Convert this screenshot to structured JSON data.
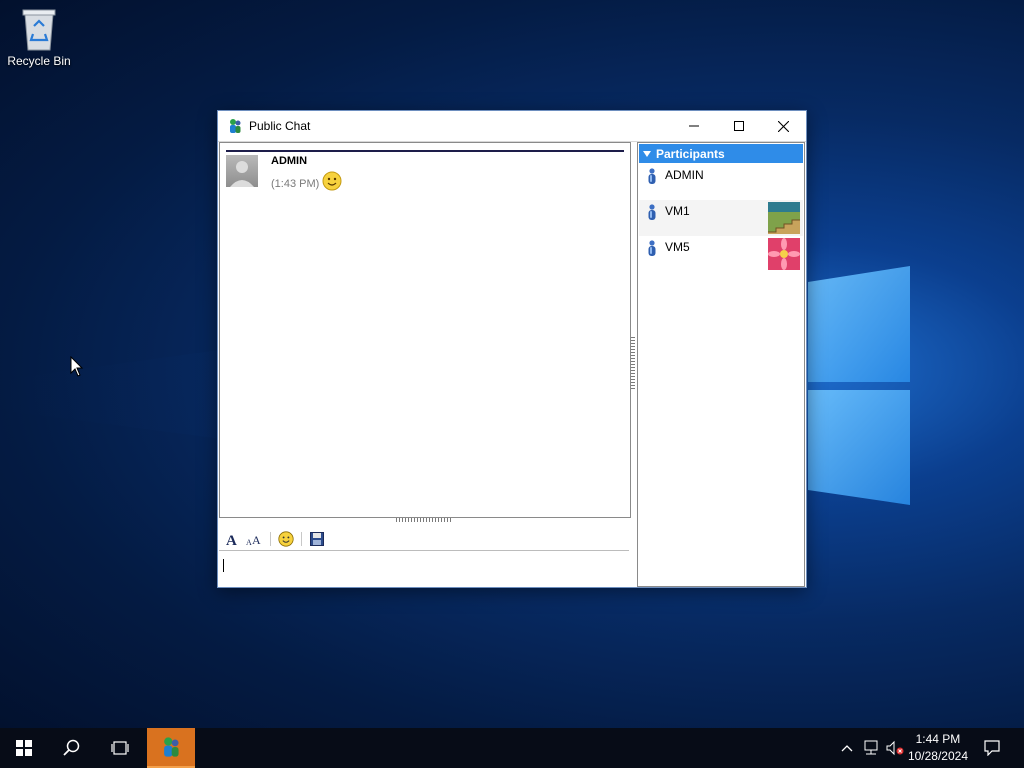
{
  "desktop": {
    "icons": [
      {
        "label": "Recycle Bin",
        "icon": "recycle-bin-icon"
      }
    ]
  },
  "window": {
    "title": "Public Chat",
    "icon": "chat-app-icon",
    "controls": {
      "minimize": "minimize-icon",
      "maximize": "maximize-icon",
      "close": "close-icon"
    }
  },
  "chat": {
    "messages": [
      {
        "sender": "ADMIN",
        "time": "(1:43 PM)",
        "emoji": "smiley-emoji"
      }
    ],
    "toolbar": [
      "font-icon",
      "font-size-icon",
      "emoticon-icon",
      "save-icon"
    ],
    "input_value": ""
  },
  "participants": {
    "header": "Participants",
    "items": [
      {
        "name": "ADMIN",
        "thumbnail": null
      },
      {
        "name": "VM1",
        "thumbnail": "stairs-thumbnail"
      },
      {
        "name": "VM5",
        "thumbnail": "flower-thumbnail"
      }
    ]
  },
  "taskbar": {
    "items": [
      "start-icon",
      "search-icon",
      "task-view-icon",
      "chat-app-icon"
    ],
    "tray": {
      "time": "1:44 PM",
      "date": "10/28/2024",
      "icons": [
        "chevron-up-icon",
        "network-icon",
        "volume-muted-icon",
        "notification-icon"
      ]
    }
  },
  "colors": {
    "participants_header": "#2f8ce8",
    "taskbar_active": "#d9721f",
    "taskbar": "#070c17"
  }
}
